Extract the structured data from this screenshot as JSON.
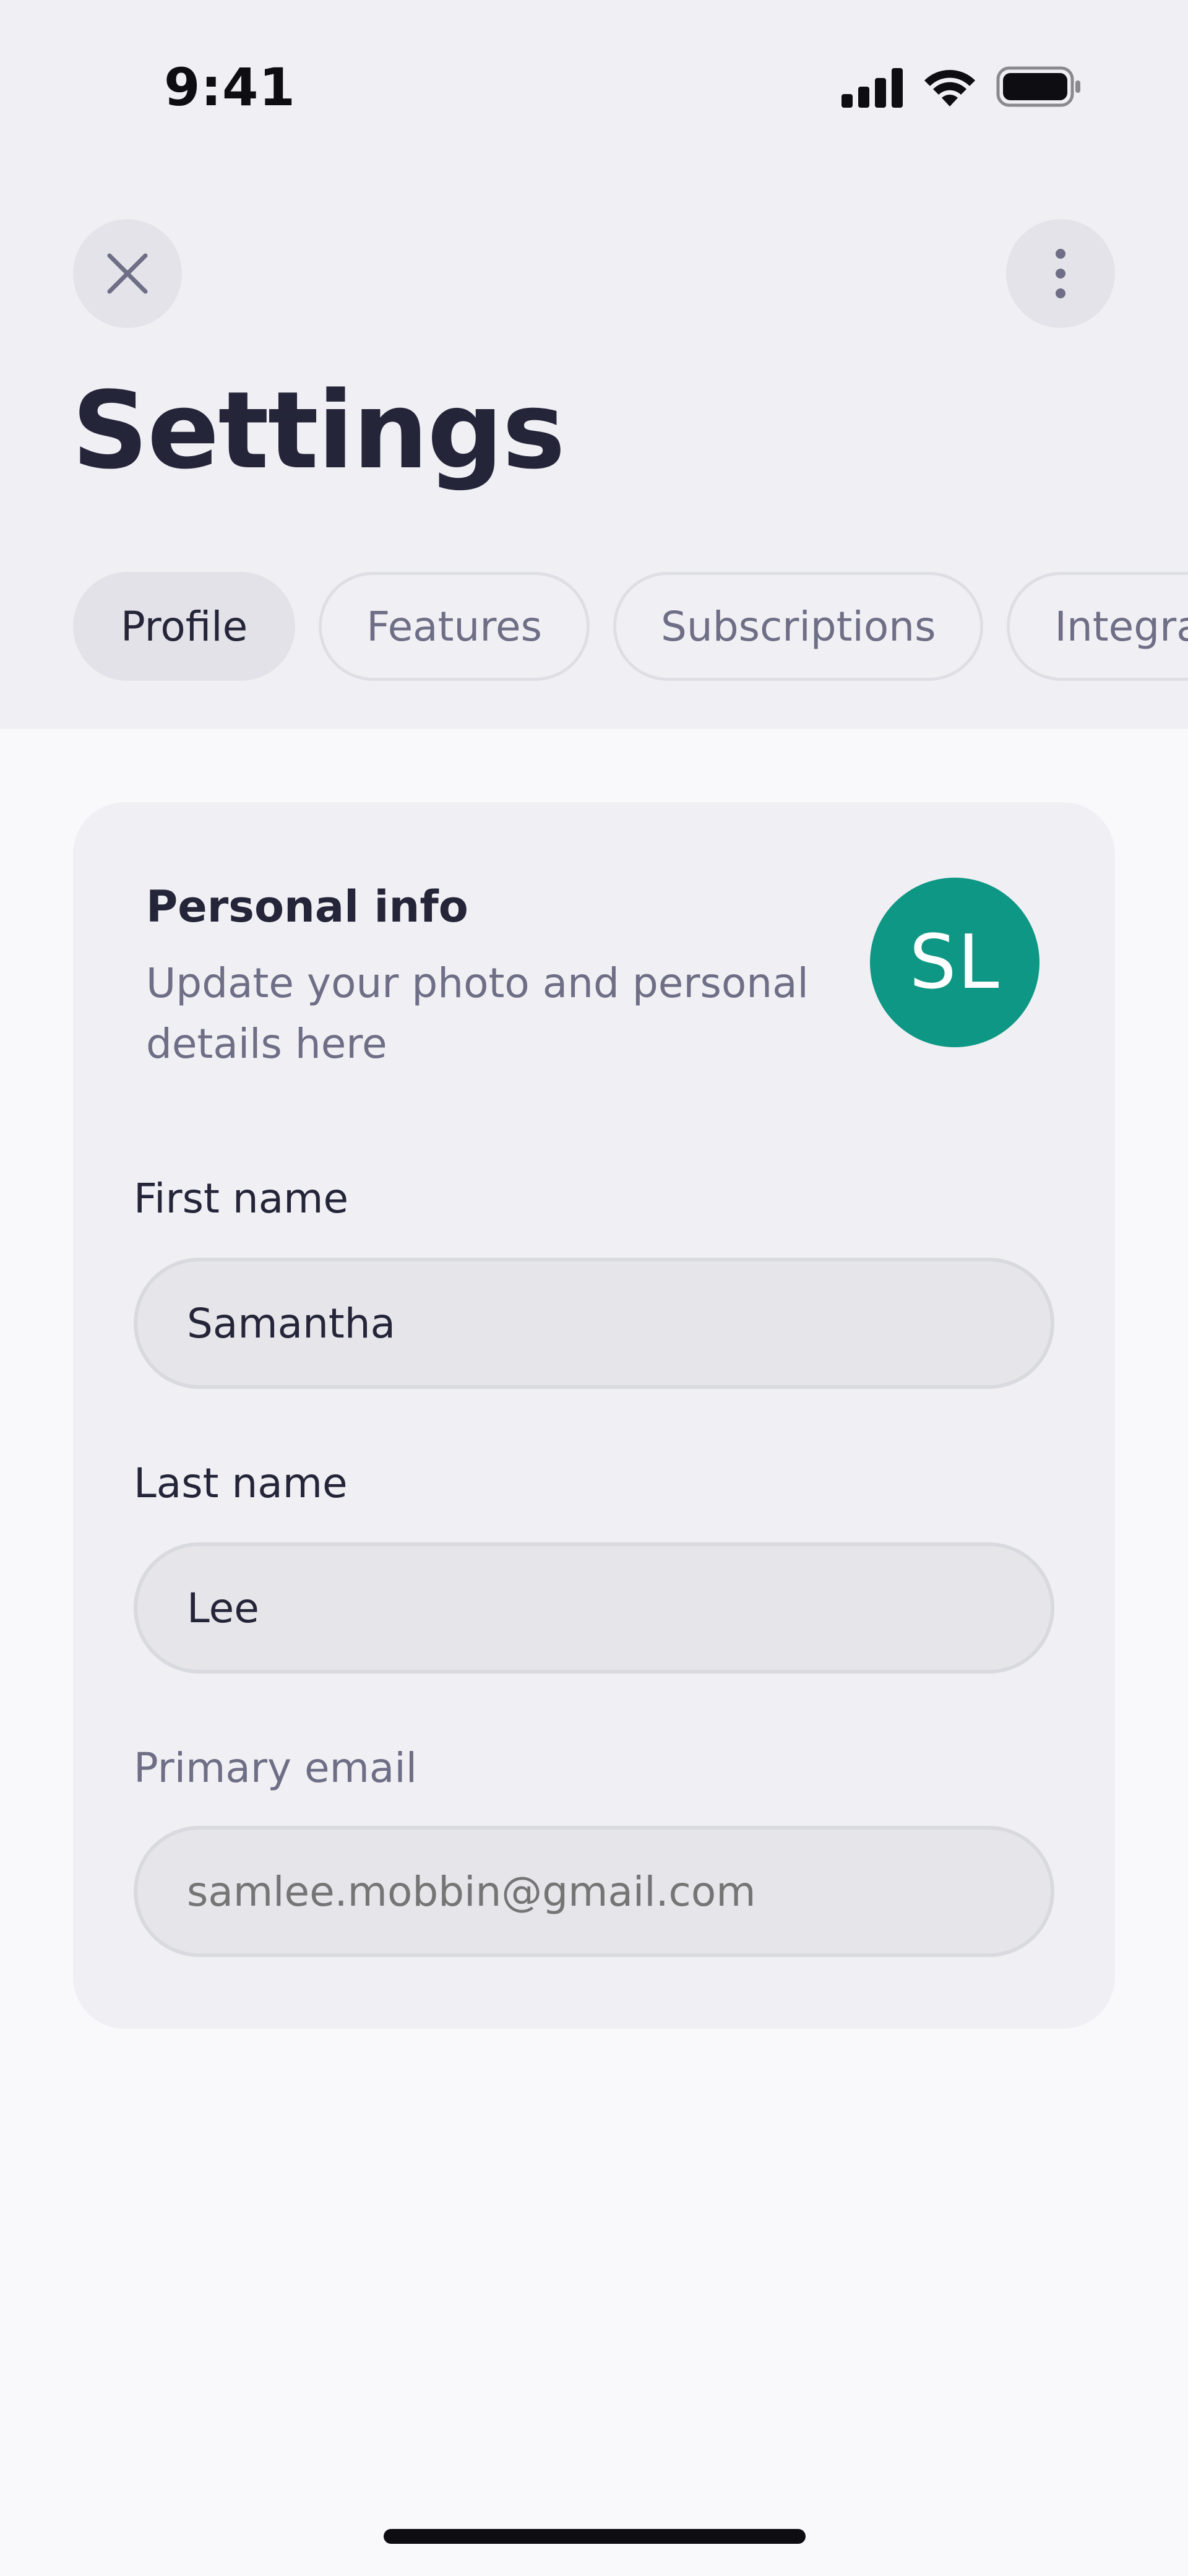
{
  "status_bar": {
    "time": "9:41",
    "icons": [
      "cellular-signal-icon",
      "wifi-icon",
      "battery-icon"
    ]
  },
  "header": {
    "close_icon": "close-icon",
    "more_icon": "more-vertical-icon",
    "title": "Settings"
  },
  "tabs": [
    {
      "label": "Profile",
      "active": true
    },
    {
      "label": "Features",
      "active": false
    },
    {
      "label": "Subscriptions",
      "active": false
    },
    {
      "label": "Integrations",
      "active": false
    }
  ],
  "personal_info": {
    "title": "Personal info",
    "subtitle": "Update your photo and personal details here",
    "avatar_initials": "SL",
    "avatar_color": "#0e9784"
  },
  "form": {
    "first_name": {
      "label": "First name",
      "value": "Samantha"
    },
    "last_name": {
      "label": "Last name",
      "value": "Lee"
    },
    "primary_email": {
      "label": "Primary email",
      "placeholder": "samlee.mobbin@gmail.com"
    }
  },
  "colors": {
    "header_bg": "#f0f0f4",
    "page_bg": "#f9f9fb",
    "text_primary": "#25253a",
    "text_secondary": "#6e6e86",
    "accent": "#0e9784"
  }
}
